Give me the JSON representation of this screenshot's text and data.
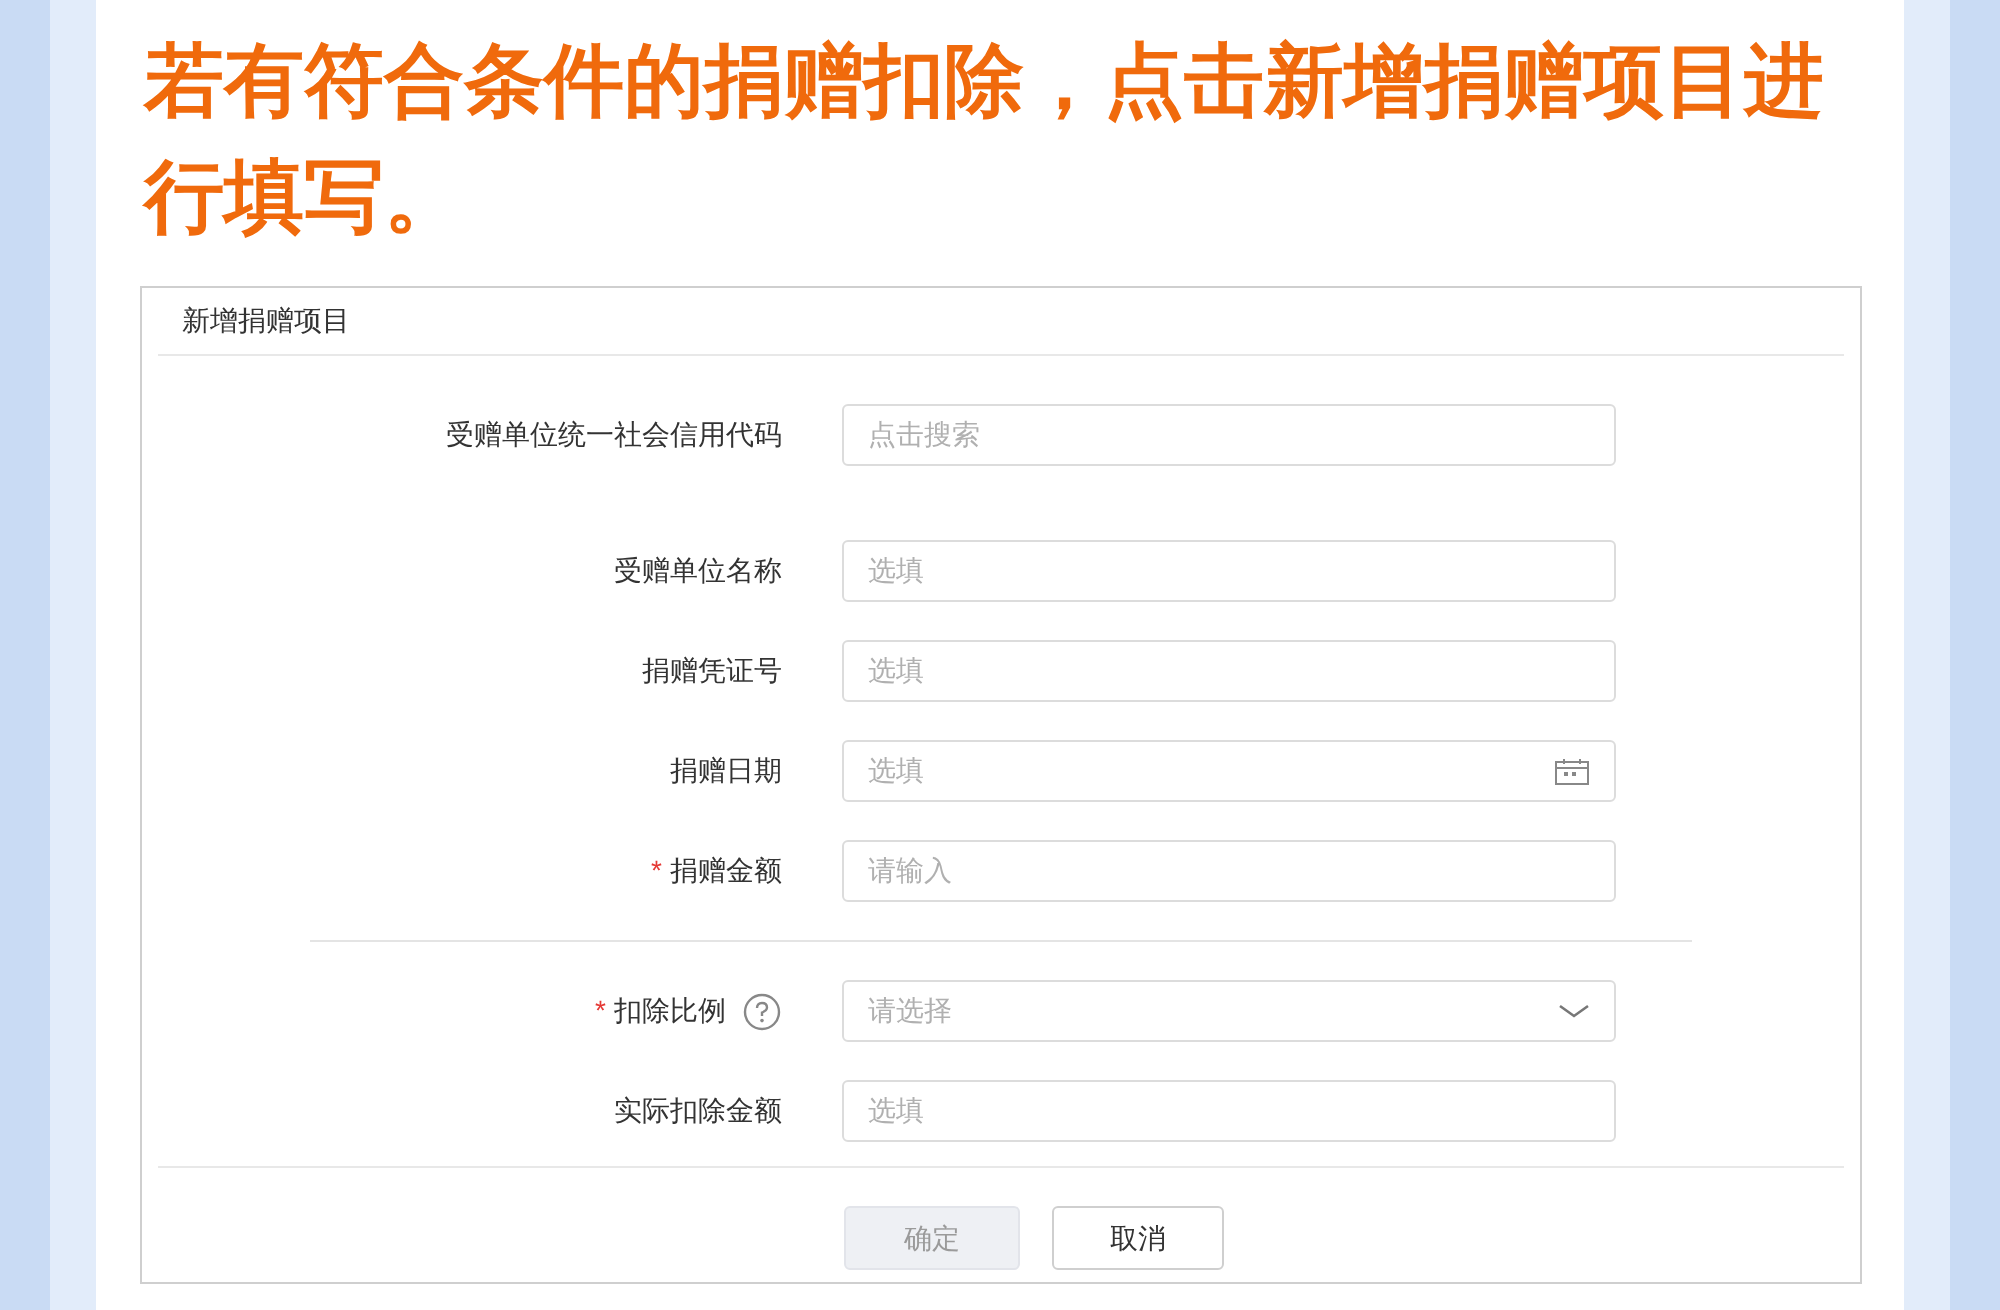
{
  "heading": "若有符合条件的捐赠扣除，点击新增捐赠项目进行填写。",
  "form": {
    "title": "新增捐赠项目",
    "sections": [
      {
        "fields": [
          {
            "kind": "text",
            "label": "受赠单位统一社会信用代码",
            "placeholder": "点击搜索",
            "help": false
          }
        ]
      },
      {
        "fields": [
          {
            "kind": "text",
            "label": "受赠单位名称",
            "placeholder": "选填",
            "help": false
          },
          {
            "kind": "text",
            "label": "捐赠凭证号",
            "placeholder": "选填",
            "help": false
          },
          {
            "kind": "date",
            "label": "捐赠日期",
            "placeholder": "选填",
            "help": false
          },
          {
            "kind": "text",
            "label": "捐赠金额",
            "placeholder": "请输入",
            "required_mark": "*",
            "help": false
          }
        ]
      },
      {
        "fields": [
          {
            "kind": "select",
            "label": "扣除比例",
            "placeholder": "请选择",
            "required_mark": "*",
            "help": true
          },
          {
            "kind": "text",
            "label": "实际扣除金额",
            "placeholder": "选填",
            "help": false
          }
        ]
      }
    ],
    "buttons": [
      {
        "label": "确定",
        "disabled": true
      },
      {
        "label": "取消",
        "disabled": false
      }
    ]
  }
}
